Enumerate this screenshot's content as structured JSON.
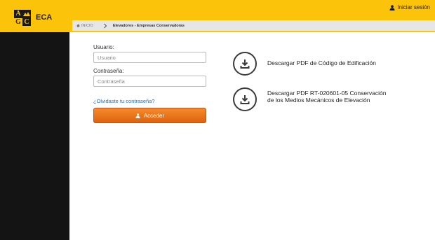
{
  "header": {
    "logo_letters": [
      "A",
      "",
      "G",
      "C"
    ],
    "brand": "ECA",
    "login_link": "Iniciar sesión",
    "background_color": "#fcc30b"
  },
  "breadcrumb": {
    "home": "INICIO",
    "current": "Elevadores - Empresas Conservadoras"
  },
  "form": {
    "username_label": "Usuario:",
    "username_placeholder": "Usuario",
    "password_label": "Contraseña:",
    "password_placeholder": "Contraseña",
    "forgot_link": "¿Olvidaste tu contraseña?",
    "submit_label": "Acceder"
  },
  "downloads": [
    {
      "line1": "Descargar PDF de Código de Edificación",
      "line2": ""
    },
    {
      "line1": "Descargar PDF RT-020601-05 Conservación",
      "line2": "de los Medios Mecánicos de Elevación"
    }
  ],
  "colors": {
    "accent": "#fcc30b",
    "button": "#ef7a1e",
    "sidebar": "#141414"
  }
}
